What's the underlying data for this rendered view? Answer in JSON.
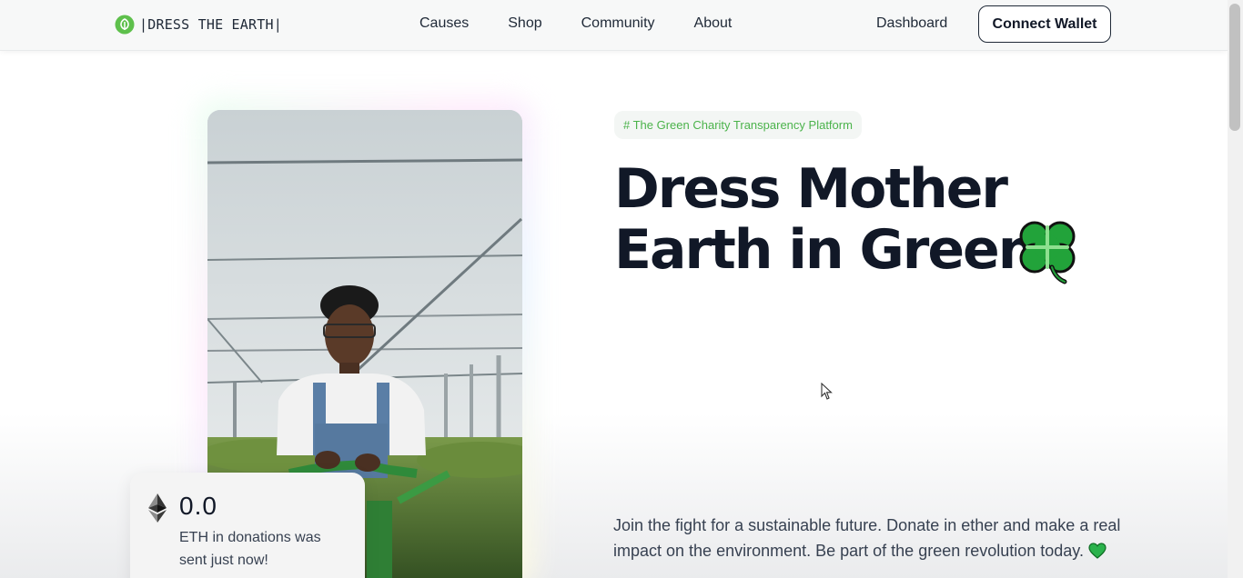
{
  "header": {
    "brand": "|DRESS THE EARTH|",
    "nav": [
      "Causes",
      "Shop",
      "Community",
      "About"
    ],
    "dashboard": "Dashboard",
    "connect_wallet": "Connect Wallet"
  },
  "hero": {
    "tagline": "# The Green Charity Transparency Platform",
    "headline_line1": "Dress Mother",
    "headline_line2": "Earth in Green.",
    "description": "Join the fight for a sustainable future. Donate in ether and make a real impact on the environment. Be part of the green revolution today."
  },
  "donation": {
    "amount": "0.0",
    "caption": "ETH in donations was sent just now!"
  },
  "colors": {
    "accent_green": "#4bb34b",
    "clover_green": "#1e9c2f",
    "text_dark": "#111827"
  },
  "icons": [
    "leaf-logo-icon",
    "ethereum-icon",
    "shamrock-icon",
    "green-heart-icon",
    "mouse-cursor-icon"
  ]
}
